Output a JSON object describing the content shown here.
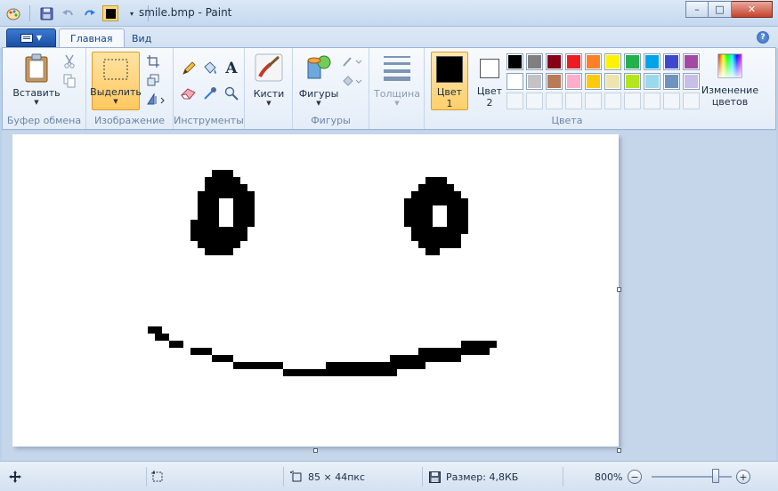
{
  "window": {
    "title": "smile.bmp - Paint",
    "controls": {
      "minimize": "–",
      "maximize": "□",
      "close": "✕"
    }
  },
  "quick_access": {
    "icons": [
      "paint-app-icon",
      "save-icon",
      "undo-icon",
      "redo-icon",
      "color-picker-icon",
      "customize-dropdown-icon"
    ]
  },
  "ribbon_tabs": [
    {
      "label": "Главная",
      "active": true
    },
    {
      "label": "Вид",
      "active": false
    }
  ],
  "help_label": "?",
  "groups": {
    "clipboard": {
      "label": "Буфер обмена",
      "paste": "Вставить"
    },
    "image": {
      "label": "Изображение",
      "select": "Выделить"
    },
    "tools": {
      "label": "Инструменты"
    },
    "brushes": {
      "label": "Кисти"
    },
    "shapes": {
      "label": "Фигуры",
      "shapes_btn": "Фигуры"
    },
    "thickness": {
      "label": "Толщина"
    },
    "colors": {
      "label": "Цвета",
      "color1_line1": "Цвет",
      "color1_line2": "1",
      "color2_line1": "Цвет",
      "color2_line2": "2",
      "edit_line1": "Изменение",
      "edit_line2": "цветов",
      "color1": "#000000",
      "color2": "#ffffff",
      "palette_row1": [
        "#000000",
        "#7f7f7f",
        "#880015",
        "#ed1c24",
        "#ff7f27",
        "#fff200",
        "#22b14c",
        "#00a2e8",
        "#3f48cc",
        "#a349a4"
      ],
      "palette_row2": [
        "#ffffff",
        "#c3c3c3",
        "#b97a57",
        "#ffaec9",
        "#ffc90e",
        "#efe4b0",
        "#b5e61d",
        "#99d9ea",
        "#7092be",
        "#c8bfe7"
      ]
    }
  },
  "status": {
    "selection_size": "85 × 44пкс",
    "file_size": "Размер: 4,8КБ",
    "zoom": "800%",
    "zoom_level": 0.8
  }
}
